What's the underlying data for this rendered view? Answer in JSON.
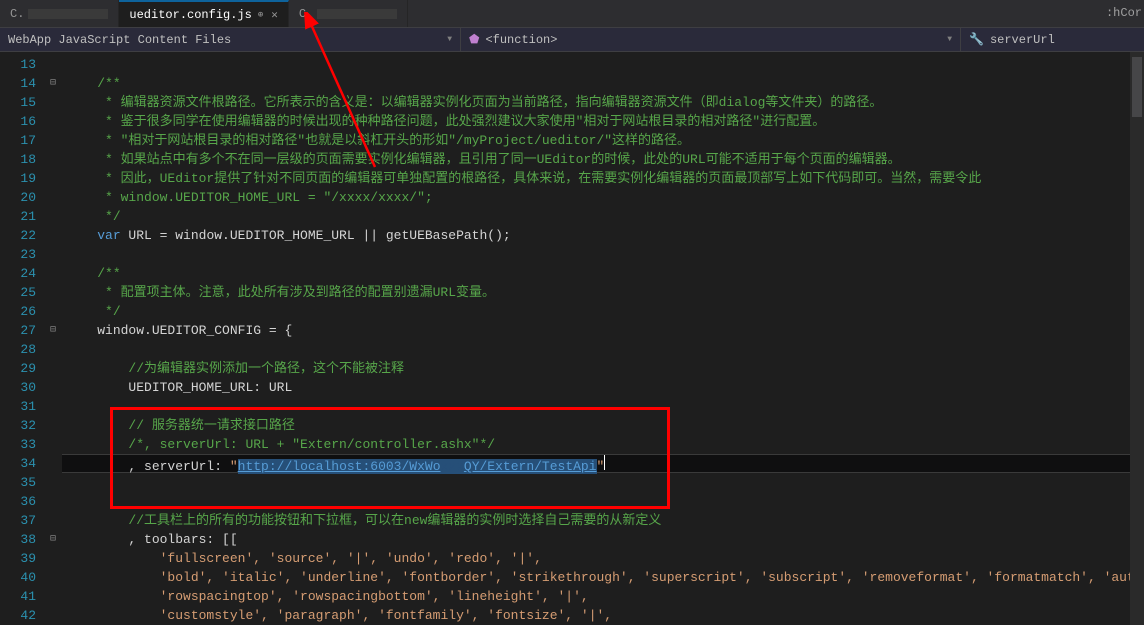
{
  "tabs": [
    {
      "label": "C.",
      "active": false
    },
    {
      "label": "ueditor.config.js",
      "active": true
    },
    {
      "label": "C.",
      "active": false
    }
  ],
  "right_tab_label": ":hCor",
  "nav": {
    "left": "WebApp JavaScript Content Files",
    "middle": "<function>",
    "right": "serverUrl"
  },
  "lines": {
    "start": 13,
    "end": 42
  },
  "code": {
    "l14": "/**",
    "l15": " * 编辑器资源文件根路径。它所表示的含义是：以编辑器实例化页面为当前路径，指向编辑器资源文件（即dialog等文件夹）的路径。",
    "l16": " * 鉴于很多同学在使用编辑器的时候出现的种种路径问题，此处强烈建议大家使用\"相对于网站根目录的相对路径\"进行配置。",
    "l17": " * \"相对于网站根目录的相对路径\"也就是以斜杠开头的形如\"/myProject/ueditor/\"这样的路径。",
    "l18": " * 如果站点中有多个不在同一层级的页面需要实例化编辑器，且引用了同一UEditor的时候，此处的URL可能不适用于每个页面的编辑器。",
    "l19": " * 因此，UEditor提供了针对不同页面的编辑器可单独配置的根路径，具体来说，在需要实例化编辑器的页面最顶部写上如下代码即可。当然，需要令此",
    "l20": " * window.UEDITOR_HOME_URL = \"/xxxx/xxxx/\";",
    "l21": " */",
    "l22_a": "var",
    "l22_b": " URL = window.UEDITOR_HOME_URL || getUEBasePath();",
    "l24": "/**",
    "l25": " * 配置项主体。注意，此处所有涉及到路径的配置别遗漏URL变量。",
    "l26": " */",
    "l27": "window.UEDITOR_CONFIG = {",
    "l29": "//为编辑器实例添加一个路径，这个不能被注释",
    "l30": "UEDITOR_HOME_URL: URL",
    "l32": "// 服务器统一请求接口路径",
    "l33": "/*, serverUrl: URL + \"Extern/controller.ashx\"*/",
    "l34_a": ", serverUrl: ",
    "l34_b": "\"",
    "l34_c": "http://localhost:6003/WxWo",
    "l34_d": "QY/Extern/TestApi",
    "l34_e": "\"",
    "l37": "//工具栏上的所有的功能按钮和下拉框，可以在new编辑器的实例时选择自己需要的从新定义",
    "l38": ", toolbars: [[",
    "l39": "    'fullscreen', 'source', '|', 'undo', 'redo', '|',",
    "l40": "    'bold', 'italic', 'underline', 'fontborder', 'strikethrough', 'superscript', 'subscript', 'removeformat', 'formatmatch', 'auto",
    "l41": "    'rowspacingtop', 'rowspacingbottom', 'lineheight', '|',",
    "l42": "    'customstyle', 'paragraph', 'fontfamily', 'fontsize', '|',"
  }
}
